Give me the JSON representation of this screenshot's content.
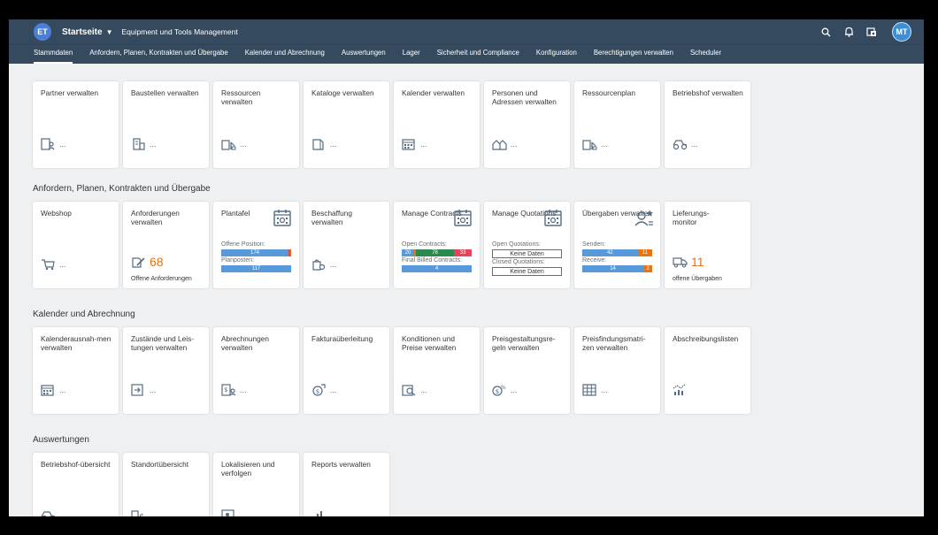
{
  "shell": {
    "logo": "ET",
    "home": "Startseite",
    "app_title": "Equipment und Tools Management",
    "avatar": "MT"
  },
  "tabs": [
    "Stammdaten",
    "Anfordern, Planen, Kontrakten und Übergabe",
    "Kalender und Abrechnung",
    "Auswertungen",
    "Lager",
    "Sicherheit und Compliance",
    "Konfiguration",
    "Berechtigungen verwalten",
    "Scheduler"
  ],
  "sections": {
    "s1": "Anfordern, Planen, Kontrakten und Übergabe",
    "s2": "Kalender und Abrechnung",
    "s3": "Auswertungen"
  },
  "tiles": {
    "partner": "Partner verwalten",
    "baustellen": "Baustellen verwalten",
    "ressourcen": "Ressourcen verwalten",
    "kataloge": "Kataloge verwalten",
    "kalender": "Kalender verwalten",
    "personen": "Personen und Adressen verwalten",
    "ressourcenplan": "Ressourcenplan",
    "betriebshof": "Betriebshof verwalten",
    "webshop": "Webshop",
    "anforderungen": "Anforderungen verwalten",
    "anforderungen_kpi": "68",
    "anforderungen_sub": "Offene Anforderungen",
    "plantafel": "Plantafel",
    "plantafel_l1": "Offene Position:",
    "plantafel_v1": "174",
    "plantafel_l2": "Planposten:",
    "plantafel_v2": "117",
    "beschaffung": "Beschaffung verwalten",
    "contracts": "Manage Contracts",
    "contracts_l1": "Open Contracts:",
    "contracts_a": "20",
    "contracts_b": "78",
    "contracts_c": "33",
    "contracts_l2": "Final Billed Contracts:",
    "contracts_d": "4",
    "quotations": "Manage Quotations",
    "quotations_l1": "Open Quotations:",
    "quotations_n1": "Keine Daten",
    "quotations_l2": "Closed Quotations:",
    "quotations_n2": "Keine Daten",
    "uebergaben": "Übergaben verwalten",
    "uebergaben_l1": "Senden:",
    "uebergaben_a": "42",
    "uebergaben_b": "11",
    "uebergaben_l2": "Receive:",
    "uebergaben_c": "14",
    "uebergaben_d": "2",
    "lieferungsmonitor": "Lieferungs-monitor",
    "lieferungsmonitor_kpi": "11",
    "lieferungsmonitor_sub": "offene Übergaben",
    "kalenderausnahmen": "Kalenderausnah-men verwalten",
    "zustaende": "Zustände und Leis-tungen verwalten",
    "abrechnungen": "Abrechnungen verwalten",
    "faktura": "Fakturaüberleitung",
    "konditionen": "Konditionen und Preise verwalten",
    "preisgestaltung": "Preisgestaltungsre-geln verwalten",
    "preisfindung": "Preisfindungsmatri-zen verwalten",
    "abschreibung": "Abschreibungslisten",
    "betriebshof_uebersicht": "Betriebshof-übersicht",
    "standort": "Standortübersicht",
    "lokalisieren": "Lokalisieren und verfolgen",
    "reports": "Reports verwalten",
    "dots": "..."
  },
  "colors": {
    "shell": "#354a5f",
    "blue": "#5899da",
    "green": "#2b8a4f",
    "red": "#e8435c",
    "orange": "#e9730c",
    "kpi": "#e9730c"
  }
}
